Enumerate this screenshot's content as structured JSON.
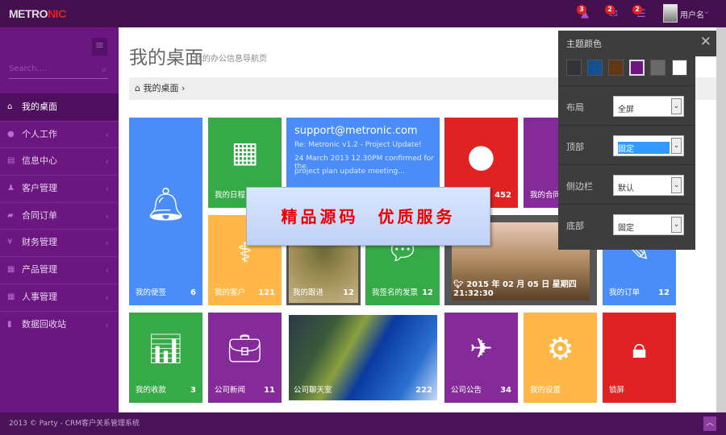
{
  "header": {
    "logo_main": "METRO",
    "logo_accent": "NIC",
    "notifications": [
      {
        "icon": "warning-icon",
        "count": "3"
      },
      {
        "icon": "inbox-icon",
        "count": "2"
      },
      {
        "icon": "tasks-icon",
        "count": "2"
      }
    ],
    "username": "用户名"
  },
  "sidebar": {
    "search_placeholder": "Search....",
    "items": [
      {
        "label": "我的桌面",
        "icon": "home-icon"
      },
      {
        "label": "个人工作",
        "icon": "user-icon"
      },
      {
        "label": "信息中心",
        "icon": "info-icon"
      },
      {
        "label": "客户管理",
        "icon": "person-icon"
      },
      {
        "label": "合同订单",
        "icon": "book-icon"
      },
      {
        "label": "财务管理",
        "icon": "yen-icon"
      },
      {
        "label": "产品管理",
        "icon": "grid-icon"
      },
      {
        "label": "人事管理",
        "icon": "grid-icon"
      },
      {
        "label": "数据回收站",
        "icon": "trash-icon"
      }
    ]
  },
  "page": {
    "title": "我的桌面",
    "subtitle": "我的办公信息导航页",
    "breadcrumb": "我的桌面"
  },
  "tiles": {
    "notes": {
      "label": "我的便签",
      "count": "6"
    },
    "schedule": {
      "label": "我的日程"
    },
    "mail": {
      "from": "support@metronic.com",
      "subject": "Re: Metronic v1.2 - Project Update!",
      "body1": "24 March 2013 12.30PM confirmed for the",
      "body2": "project plan update meeting..."
    },
    "users": {
      "count": "452"
    },
    "contracts": {
      "label": "我的合同"
    },
    "customers": {
      "label": "我的客户",
      "count": "121"
    },
    "followup": {
      "label": "我的跟进",
      "count": "12"
    },
    "invoices": {
      "label": "我签名的发票",
      "count": "12"
    },
    "camera": {
      "datetime": "2015 年 02 月 05 日 星期四 21:32:30"
    },
    "orders": {
      "label": "我的订单",
      "count": "12"
    },
    "receipts": {
      "label": "我的收款",
      "count": "3"
    },
    "news": {
      "label": "公司新闻",
      "count": "11"
    },
    "chat": {
      "label": "公司聊天室",
      "count": "222"
    },
    "notice": {
      "label": "公司公告",
      "count": "34"
    },
    "settings": {
      "label": "我的设置"
    },
    "lock": {
      "label": "锁屏"
    }
  },
  "banner": {
    "text": "精品源码　优质服务"
  },
  "theme_panel": {
    "title": "主题颜色",
    "colors": [
      "#333438",
      "#12508f",
      "#603813",
      "#6f1681",
      "#6a6a6a",
      "#ffffff"
    ],
    "selected_color": "#6f1681",
    "rows": [
      {
        "label": "布局",
        "value": "全屏"
      },
      {
        "label": "顶部",
        "value": "固定"
      },
      {
        "label": "侧边栏",
        "value": "默认"
      },
      {
        "label": "底部",
        "value": "固定"
      }
    ]
  },
  "footer": {
    "text": "2013 © Party - CRM客户关系管理系统"
  }
}
